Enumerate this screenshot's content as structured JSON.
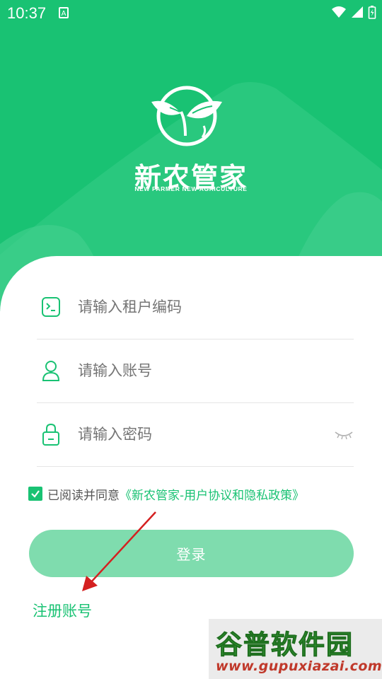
{
  "status_bar": {
    "time": "10:37",
    "notification_icon": "a-badge-icon",
    "icons": [
      "wifi-icon",
      "signal-icon",
      "battery-icon"
    ]
  },
  "brand": {
    "name": "新农管家",
    "tagline": "NEW FARMER NEW AGRICULTURE",
    "logo_icon": "sprout-leaf-logo"
  },
  "form": {
    "tenant_code": {
      "placeholder": "请输入租户编码",
      "value": "",
      "icon": "terminal-icon"
    },
    "account": {
      "placeholder": "请输入账号",
      "value": "",
      "icon": "user-icon"
    },
    "password": {
      "placeholder": "请输入密码",
      "value": "",
      "icon": "lock-icon",
      "toggle_icon": "eye-closed-icon"
    }
  },
  "agreement": {
    "checked": true,
    "text": "已阅读并同意",
    "link": "《新农管家-用户协议和隐私政策》"
  },
  "login_button": {
    "label": "登录"
  },
  "register_link": {
    "label": "注册账号"
  },
  "watermark": {
    "title": "谷普软件园",
    "url": "www.gupuxiazai.com"
  },
  "colors": {
    "brand_green": "#19c273",
    "button_disabled": "#7fdcae",
    "annotation_arrow": "#d42020"
  }
}
